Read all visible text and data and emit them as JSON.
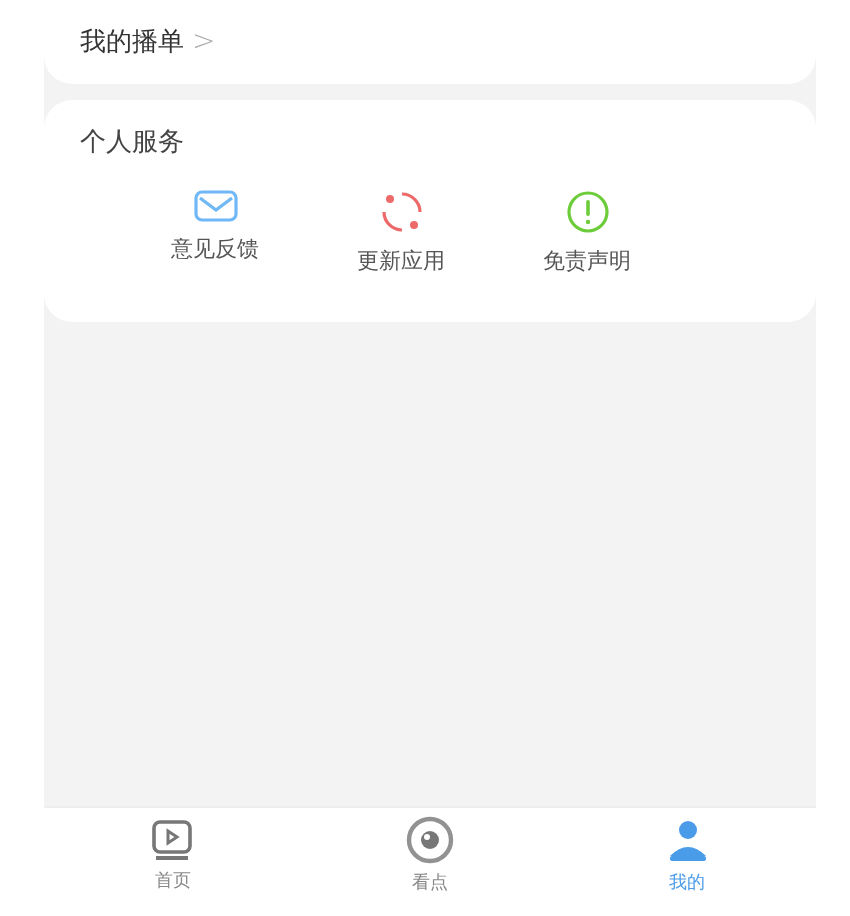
{
  "playlist_link": {
    "label": "我的播单",
    "chevron": ">"
  },
  "services": {
    "title": "个人服务",
    "items": [
      {
        "kind": "mail",
        "label": "意见反馈",
        "color": "#6fb8f5"
      },
      {
        "kind": "refresh",
        "label": "更新应用",
        "color": "#ec6a6a"
      },
      {
        "kind": "alert",
        "label": "免责声明",
        "color": "#6dcc3a"
      }
    ]
  },
  "tabs": [
    {
      "kind": "home",
      "label": "首页",
      "selected": false
    },
    {
      "kind": "watch",
      "label": "看点",
      "selected": false
    },
    {
      "kind": "me",
      "label": "我的",
      "selected": true
    }
  ]
}
